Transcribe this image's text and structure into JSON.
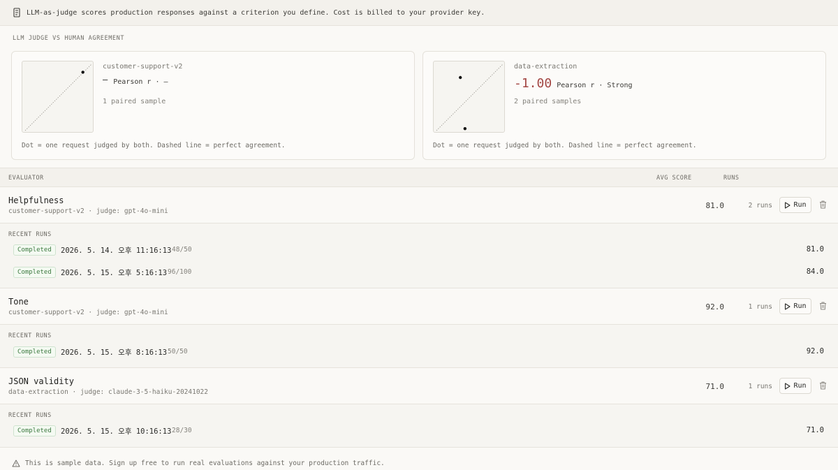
{
  "banner": {
    "icon": "document-icon",
    "text": "LLM-as-judge scores production responses against a criterion you define. Cost is billed to your provider key."
  },
  "agreement": {
    "section_label": "LLM JUDGE VS HUMAN AGREEMENT",
    "cards": [
      {
        "evaluator": "customer-support-v2",
        "correlation": "—",
        "correlation_label": "Pearson r · –",
        "samples": "1 paired sample",
        "caption": "Dot = one request judged by both. Dashed line = perfect agreement.",
        "points": [
          {
            "human": 0.87,
            "judge": 0.88
          }
        ]
      },
      {
        "evaluator": "data-extraction",
        "correlation": "-1.00",
        "correlation_label": "Pearson r · Strong",
        "samples": "2 paired samples",
        "caption": "Dot = one request judged by both. Dashed line = perfect agreement.",
        "points": [
          {
            "human": 0.36,
            "judge": 0.8
          },
          {
            "human": 0.43,
            "judge": 0.03
          }
        ]
      }
    ]
  },
  "table": {
    "col_evaluator": "EVALUATOR",
    "col_avg": "AVG SCORE",
    "col_runs": "RUNS",
    "recent_label": "RECENT RUNS",
    "run_button": "Run",
    "evaluators": [
      {
        "name": "Helpfulness",
        "meta": "customer-support-v2 · judge: gpt-4o-mini",
        "avg": "81.0",
        "runs": "2 runs",
        "recent": [
          {
            "status": "Completed",
            "date": "2026. 5. 14. 오후 11:16:13",
            "frac": "48/50",
            "score": "81.0"
          },
          {
            "status": "Completed",
            "date": "2026. 5. 15. 오후 5:16:13",
            "frac": "96/100",
            "score": "84.0"
          }
        ]
      },
      {
        "name": "Tone",
        "meta": "customer-support-v2 · judge: gpt-4o-mini",
        "avg": "92.0",
        "runs": "1 runs",
        "recent": [
          {
            "status": "Completed",
            "date": "2026. 5. 15. 오후 8:16:13",
            "frac": "50/50",
            "score": "92.0"
          }
        ]
      },
      {
        "name": "JSON validity",
        "meta": "data-extraction · judge: claude-3-5-haiku-20241022",
        "avg": "71.0",
        "runs": "1 runs",
        "recent": [
          {
            "status": "Completed",
            "date": "2026. 5. 15. 오후 10:16:13",
            "frac": "28/30",
            "score": "71.0"
          }
        ]
      }
    ]
  },
  "footer": {
    "icon": "warning-icon",
    "text": "This is sample data. Sign up free to run real evaluations against your production traffic."
  }
}
